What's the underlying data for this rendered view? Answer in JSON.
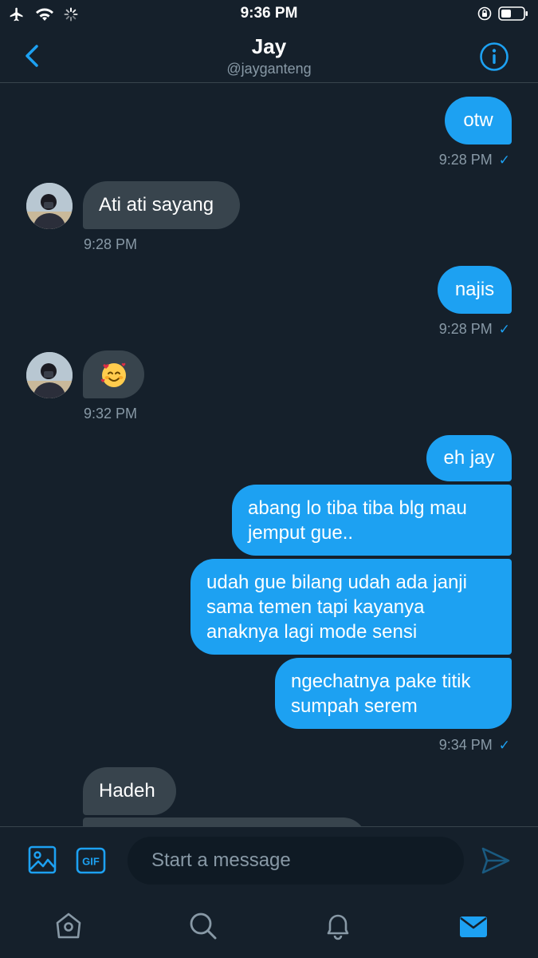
{
  "status_bar": {
    "time": "9:36 PM",
    "icons": [
      "airplane-icon",
      "wifi-icon",
      "loading-icon",
      "orientation-lock-icon",
      "battery-icon"
    ]
  },
  "header": {
    "name": "Jay",
    "handle": "@jayganteng",
    "back_icon": "chevron-left-icon",
    "info_icon": "info-icon"
  },
  "messages": [
    {
      "side": "sent",
      "text": "otw",
      "time": "9:28 PM",
      "read": "✓"
    },
    {
      "side": "received",
      "text": "Ati ati sayang",
      "time": "9:28 PM"
    },
    {
      "side": "sent",
      "text": "najis",
      "time": "9:28 PM",
      "read": "✓"
    },
    {
      "side": "received",
      "text": "🥰",
      "time": "9:32 PM"
    },
    {
      "side": "sent",
      "group": [
        "eh jay",
        "abang lo tiba tiba blg mau jemput gue..",
        "udah gue bilang udah ada janji sama temen tapi kayanya anaknya lagi mode sensi",
        "ngechatnya pake titik sumpah serem"
      ],
      "time": "9:34 PM",
      "read": "✓"
    },
    {
      "side": "received",
      "text": "Hadeh"
    }
  ],
  "composer": {
    "placeholder": "Start a message",
    "image_icon": "image-icon",
    "gif_label": "GIF",
    "send_icon": "send-icon"
  },
  "tabbar": {
    "items": [
      "home-icon",
      "search-icon",
      "notifications-icon",
      "messages-icon"
    ],
    "active": "messages-icon"
  },
  "colors": {
    "background": "#15202b",
    "accent": "#1da1f2",
    "received_bubble": "#38444d",
    "muted_text": "#8899a6"
  }
}
